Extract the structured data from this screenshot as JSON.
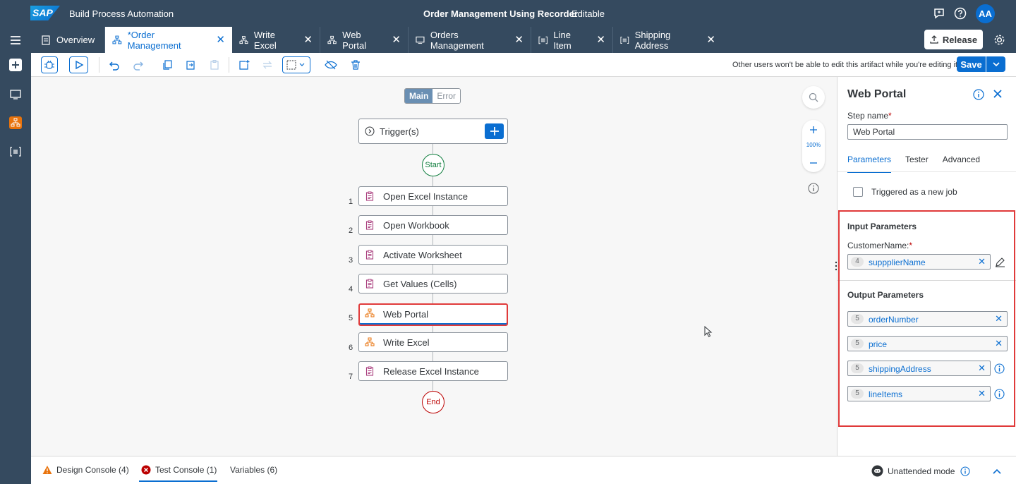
{
  "shell": {
    "logo": "SAP",
    "product": "Build Process Automation",
    "title": "Order Management Using Recorder",
    "state": "Editable",
    "avatar": "AA"
  },
  "tabs": [
    {
      "label": "Overview"
    },
    {
      "label": "*Order Management"
    },
    {
      "label": "Write Excel"
    },
    {
      "label": "Web Portal"
    },
    {
      "label": "Orders Management"
    },
    {
      "label": "Line Item"
    },
    {
      "label": "Shipping Address"
    }
  ],
  "release_label": "Release",
  "toolbar": {
    "note": "Other users won't be able to edit this artifact while you're editing it.",
    "save_label": "Save"
  },
  "canvas": {
    "mode_main": "Main",
    "mode_error": "Error",
    "trigger_label": "Trigger(s)",
    "start_label": "Start",
    "end_label": "End",
    "zoom": "100%",
    "steps": [
      {
        "num": "1",
        "label": "Open Excel Instance",
        "icon": "clipboard-icon"
      },
      {
        "num": "2",
        "label": "Open Workbook",
        "icon": "clipboard-icon"
      },
      {
        "num": "3",
        "label": "Activate Worksheet",
        "icon": "clipboard-icon"
      },
      {
        "num": "4",
        "label": "Get Values (Cells)",
        "icon": "clipboard-icon"
      },
      {
        "num": "5",
        "label": "Web Portal",
        "icon": "hierarchy-icon"
      },
      {
        "num": "6",
        "label": "Write Excel",
        "icon": "hierarchy-icon"
      },
      {
        "num": "7",
        "label": "Release Excel Instance",
        "icon": "clipboard-icon"
      }
    ]
  },
  "panel": {
    "title": "Web Portal",
    "step_name_label": "Step name",
    "step_name_value": "Web Portal",
    "tabs": [
      "Parameters",
      "Tester",
      "Advanced"
    ],
    "triggered_label": "Triggered as a new job",
    "input_title": "Input Parameters",
    "customer_label": "CustomerName:",
    "input_token": {
      "num": "4",
      "value": "suppplierName"
    },
    "output_title": "Output Parameters",
    "outputs": [
      {
        "num": "5",
        "value": "orderNumber"
      },
      {
        "num": "5",
        "value": "price"
      },
      {
        "num": "5",
        "value": "shippingAddress"
      },
      {
        "num": "5",
        "value": "lineItems"
      }
    ]
  },
  "bottom": {
    "design": "Design Console (4)",
    "test": "Test Console (1)",
    "variables": "Variables (6)",
    "unattended": "Unattended mode"
  },
  "colors": {
    "brand": "#0a6ed1",
    "shell": "#354a5f",
    "error": "#bb0000",
    "success": "#107e3e",
    "highlight": "#e03a3a"
  }
}
